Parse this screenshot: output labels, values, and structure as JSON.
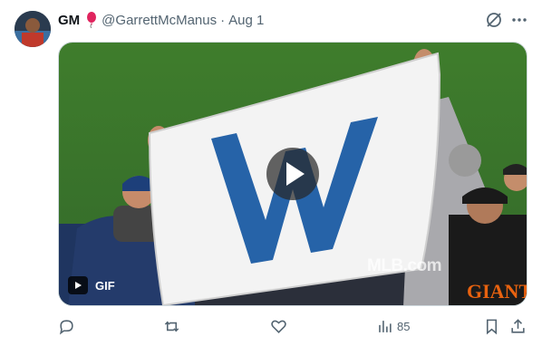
{
  "tweet": {
    "display_name": "GM",
    "handle": "@GarrettMcManus",
    "separator": "·",
    "date": "Aug 1"
  },
  "media": {
    "type_badge": "GIF",
    "watermark": "MLB.com",
    "flag_letter": "W",
    "jersey_text": "GIANTS"
  },
  "actions": {
    "views": "85"
  },
  "colors": {
    "text_primary": "#0f1419",
    "text_secondary": "#536471",
    "flag_blue": "#2663a8",
    "grass": "#3e7b2c"
  }
}
